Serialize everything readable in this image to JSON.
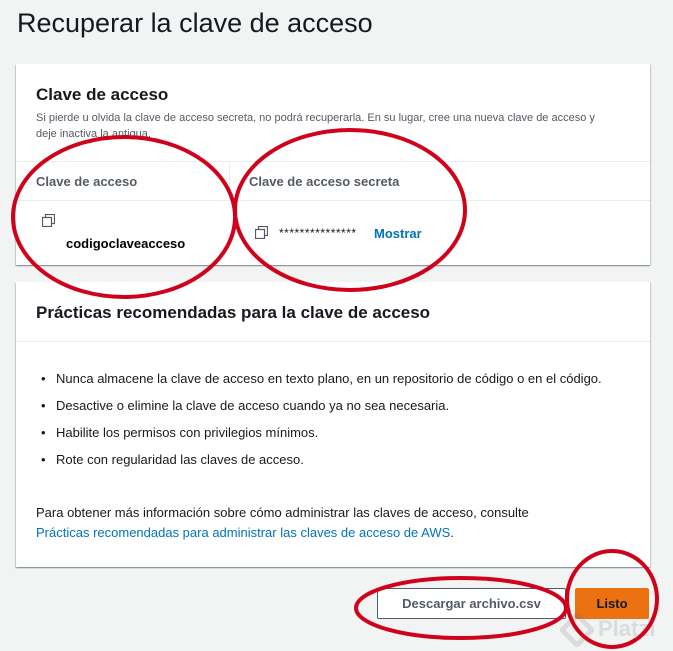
{
  "page": {
    "title": "Recuperar la clave de acceso"
  },
  "access_key_card": {
    "title": "Clave de acceso",
    "description": "Si pierde u olvida la clave de acceso secreta, no podrá recuperarla. En su lugar, cree una nueva clave de acceso y deje inactiva la antigua.",
    "columns": {
      "access_key_header": "Clave de acceso",
      "secret_key_header": "Clave de acceso secreta"
    },
    "access_key_value": "codigoclaveacceso",
    "secret_key_masked": "***************",
    "show_label": "Mostrar"
  },
  "practices_card": {
    "title": "Prácticas recomendadas para la clave de acceso",
    "items": [
      "Nunca almacene la clave de acceso en texto plano, en un repositorio de código o en el código.",
      "Desactive o elimine la clave de acceso cuando ya no sea necesaria.",
      "Habilite los permisos con privilegios mínimos.",
      "Rote con regularidad las claves de acceso."
    ],
    "more_info_text": "Para obtener más información sobre cómo administrar las claves de acceso, consulte",
    "more_info_link": "Prácticas recomendadas para administrar las claves de acceso de AWS",
    "more_info_suffix": "."
  },
  "actions": {
    "download_label": "Descargar archivo.csv",
    "done_label": "Listo"
  },
  "watermark": {
    "text": "Platzi"
  },
  "colors": {
    "link": "#0073bb",
    "primary_button": "#ec7211",
    "annotation": "#d0021b",
    "background": "#f2f3f3"
  },
  "icons": {
    "copy": "copy-icon",
    "bullet": "bullet-dot"
  }
}
